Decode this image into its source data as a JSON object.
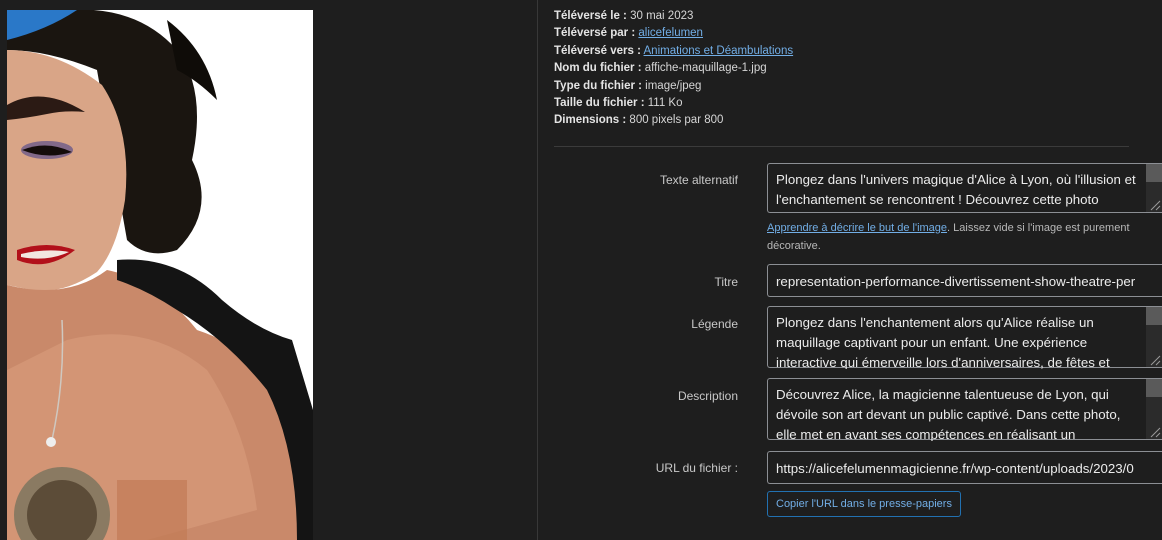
{
  "metadata": {
    "uploaded_on_label": "Téléversé le :",
    "uploaded_on_value": "30 mai 2023",
    "uploaded_by_label": "Téléversé par :",
    "uploaded_by_value": "alicefelumen",
    "uploaded_to_label": "Téléversé vers :",
    "uploaded_to_value": "Animations et Déambulations",
    "file_name_label": "Nom du fichier :",
    "file_name_value": "affiche-maquillage-1.jpg",
    "file_type_label": "Type du fichier :",
    "file_type_value": "image/jpeg",
    "file_size_label": "Taille du fichier :",
    "file_size_value": "111 Ko",
    "dimensions_label": "Dimensions :",
    "dimensions_value": "800 pixels par 800"
  },
  "fields": {
    "alt_label": "Texte alternatif",
    "alt_value": "Plongez dans l'univers magique d'Alice à Lyon, où l'illusion et l'enchantement se rencontrent ! Découvrez cette photo",
    "alt_hint_link": "Apprendre à décrire le but de l'image",
    "alt_hint_text": ". Laissez vide si l'image est purement décorative.",
    "title_label": "Titre",
    "title_value": "representation-performance-divertissement-show-theatre-per",
    "caption_label": "Légende",
    "caption_value": "Plongez dans l'enchantement alors qu'Alice réalise un maquillage captivant pour un enfant. Une expérience interactive qui émerveille lors d'anniversaires, de fêtes et",
    "description_label": "Description",
    "description_value": "Découvrez Alice, la magicienne talentueuse de Lyon, qui dévoile son art devant un public captivé. Dans cette photo, elle met en avant ses compétences en réalisant un",
    "url_label": "URL du fichier :",
    "url_value": "https://alicefelumenmagicienne.fr/wp-content/uploads/2023/0",
    "copy_button": "Copier l'URL dans le presse-papiers"
  },
  "colors": {
    "background": "#1e1e1e",
    "link": "#72aee6",
    "button_border": "#2271b1"
  }
}
